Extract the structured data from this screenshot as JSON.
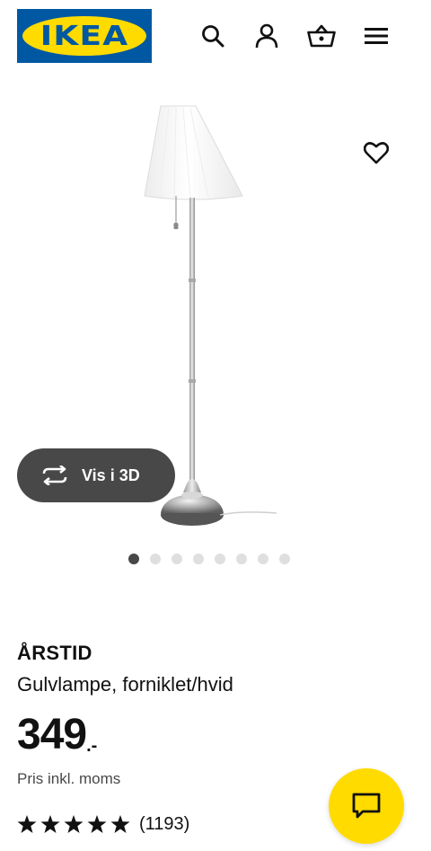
{
  "header": {
    "logo_text": "IKEA",
    "icons": [
      "search-icon",
      "account-icon",
      "basket-icon",
      "menu-icon"
    ]
  },
  "gallery": {
    "view3d_label": "Vis i 3D",
    "image_count": 8,
    "active_index": 0
  },
  "product": {
    "name": "ÅRSTID",
    "description": "Gulvlampe, forniklet/hvid",
    "price_integer": "349",
    "price_suffix": ".-",
    "price_note": "Pris inkl. moms",
    "rating_count": "(1193)",
    "rating_stars": 5
  },
  "colors": {
    "brand_blue": "#0058a3",
    "brand_yellow": "#ffdb00",
    "dark_grey": "#484848"
  }
}
